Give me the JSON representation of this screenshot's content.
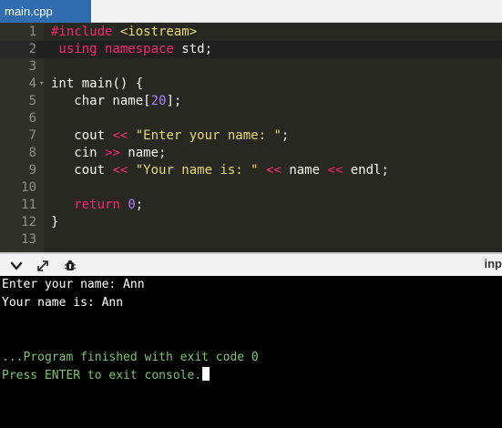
{
  "tab": {
    "label": "main.cpp"
  },
  "editor": {
    "active_line": 2,
    "lines": [
      {
        "n": "1",
        "tokens": [
          {
            "t": "#include ",
            "c": "pp"
          },
          {
            "t": "<iostream>",
            "c": "str"
          }
        ]
      },
      {
        "n": "2",
        "tokens": [
          {
            "t": " using namespace ",
            "c": "kw"
          },
          {
            "t": "std;",
            "c": "plain"
          }
        ]
      },
      {
        "n": "3",
        "tokens": []
      },
      {
        "n": "4",
        "fold": true,
        "tokens": [
          {
            "t": "int main() {",
            "c": "plain"
          }
        ]
      },
      {
        "n": "5",
        "tokens": [
          {
            "t": "   char name[",
            "c": "plain"
          },
          {
            "t": "20",
            "c": "num"
          },
          {
            "t": "];",
            "c": "plain"
          }
        ]
      },
      {
        "n": "6",
        "tokens": []
      },
      {
        "n": "7",
        "tokens": [
          {
            "t": "   cout ",
            "c": "plain"
          },
          {
            "t": "<<",
            "c": "op"
          },
          {
            "t": " ",
            "c": "plain"
          },
          {
            "t": "\"Enter your name: \"",
            "c": "str"
          },
          {
            "t": ";",
            "c": "plain"
          }
        ]
      },
      {
        "n": "8",
        "tokens": [
          {
            "t": "   cin ",
            "c": "plain"
          },
          {
            "t": ">>",
            "c": "op"
          },
          {
            "t": " name;",
            "c": "plain"
          }
        ]
      },
      {
        "n": "9",
        "tokens": [
          {
            "t": "   cout ",
            "c": "plain"
          },
          {
            "t": "<<",
            "c": "op"
          },
          {
            "t": " ",
            "c": "plain"
          },
          {
            "t": "\"Your name is: \"",
            "c": "str"
          },
          {
            "t": " ",
            "c": "plain"
          },
          {
            "t": "<<",
            "c": "op"
          },
          {
            "t": " name ",
            "c": "plain"
          },
          {
            "t": "<<",
            "c": "op"
          },
          {
            "t": " endl;",
            "c": "plain"
          }
        ]
      },
      {
        "n": "10",
        "tokens": []
      },
      {
        "n": "11",
        "tokens": [
          {
            "t": "   ",
            "c": "plain"
          },
          {
            "t": "return",
            "c": "kw"
          },
          {
            "t": " ",
            "c": "plain"
          },
          {
            "t": "0",
            "c": "num"
          },
          {
            "t": ";",
            "c": "plain"
          }
        ]
      },
      {
        "n": "12",
        "tokens": [
          {
            "t": "}",
            "c": "plain"
          }
        ]
      },
      {
        "n": "13",
        "tokens": []
      }
    ]
  },
  "console_toolbar": {
    "buttons": [
      {
        "name": "chevron-down-icon"
      },
      {
        "name": "expand-icon"
      },
      {
        "name": "debug-icon"
      }
    ],
    "input_label": "inp"
  },
  "console": {
    "lines": [
      {
        "text": "Enter your name: Ann",
        "color": "white"
      },
      {
        "text": "Your name is: Ann",
        "color": "white"
      },
      {
        "text": "",
        "color": "white"
      },
      {
        "text": "",
        "color": "white"
      },
      {
        "text": "...Program finished with exit code 0",
        "color": "green"
      },
      {
        "text": "Press ENTER to exit console.",
        "color": "green",
        "cursor": true
      }
    ]
  },
  "colors": {
    "tab_bg": "#2f6db0",
    "editor_bg": "#272822",
    "console_bg": "#000000",
    "console_green": "#7cc46f"
  }
}
